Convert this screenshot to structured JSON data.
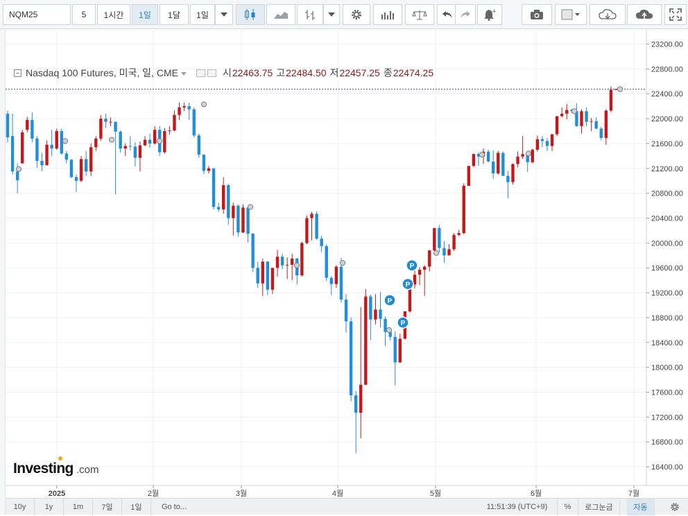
{
  "toolbar": {
    "symbol": "NQM25",
    "interval_value": "5",
    "buttons": [
      "1시간",
      "1일",
      "1달",
      "1일"
    ],
    "active_index": 1
  },
  "legend": {
    "title": "Nasdaq 100 Futures, 미국, 일, CME",
    "open_label": "시",
    "open": "22463.75",
    "high_label": "고",
    "high": "22484.50",
    "low_label": "저",
    "low": "22457.25",
    "close_label": "종",
    "close": "22474.25"
  },
  "colors": {
    "up": "#c8171b",
    "down": "#1e8fd8",
    "price_tag": "#1f8ad6",
    "grid": "#eef0f2"
  },
  "bottombar": {
    "ranges": [
      "10y",
      "1y",
      "1m",
      "7일",
      "1일"
    ],
    "goto": "Go to...",
    "clock": "11:51:39 (UTC+9)",
    "percent": "%",
    "log": "로그눈금",
    "auto": "자동"
  },
  "chart_data": {
    "type": "candlestick",
    "y_axis_ticks": [
      23200,
      22800,
      22400,
      22000,
      21600,
      21200,
      20800,
      20400,
      20000,
      19600,
      19200,
      18800,
      18400,
      18000,
      17600,
      17200,
      16800,
      16400
    ],
    "y_axis_tick_labels": [
      "23200.00",
      "22800.00",
      "22400.00",
      "22000.00",
      "21600.00",
      "21200.00",
      "20800.00",
      "20400.00",
      "20000.00",
      "19600.00",
      "19200.00",
      "18800.00",
      "18400.00",
      "18000.00",
      "17600.00",
      "17200.00",
      "16800.00",
      "16400.00"
    ],
    "ylim": [
      16100,
      23440
    ],
    "x_axis_labels": [
      "2025",
      "2월",
      "3월",
      "4월",
      "5월",
      "6월",
      "7월"
    ],
    "last_price": 22474.25,
    "last_price_label": "22474.25",
    "dividend_marker_label": "P",
    "candles": [
      [
        22080,
        22130,
        21620,
        21700
      ],
      [
        21720,
        22080,
        21100,
        21150
      ],
      [
        21150,
        21280,
        20800,
        21010
      ],
      [
        21280,
        21820,
        21280,
        21780
      ],
      [
        21820,
        22030,
        21780,
        21980
      ],
      [
        21980,
        22100,
        21620,
        21680
      ],
      [
        21680,
        21720,
        21210,
        21320
      ],
      [
        21320,
        21450,
        21150,
        21250
      ],
      [
        21250,
        21650,
        21250,
        21580
      ],
      [
        21580,
        21820,
        21400,
        21520
      ],
      [
        21520,
        21840,
        21500,
        21800
      ],
      [
        21800,
        21840,
        21420,
        21440
      ],
      [
        21440,
        21480,
        21280,
        21340
      ],
      [
        21340,
        21350,
        21040,
        21060
      ],
      [
        21060,
        21100,
        20820,
        21000
      ],
      [
        21000,
        21400,
        20980,
        21350
      ],
      [
        21350,
        21480,
        21080,
        21150
      ],
      [
        21150,
        21600,
        21080,
        21540
      ],
      [
        21540,
        21720,
        21480,
        21680
      ],
      [
        21680,
        22060,
        21640,
        22000
      ],
      [
        22000,
        22080,
        21850,
        21950
      ],
      [
        21950,
        22020,
        21880,
        21950
      ],
      [
        21950,
        21780,
        20780,
        21790
      ],
      [
        21790,
        21810,
        21450,
        21520
      ],
      [
        21520,
        21600,
        21400,
        21560
      ],
      [
        21560,
        21720,
        21490,
        21550
      ],
      [
        21550,
        21620,
        21230,
        21370
      ],
      [
        21370,
        21630,
        21150,
        21570
      ],
      [
        21570,
        21720,
        21560,
        21660
      ],
      [
        21660,
        21760,
        21530,
        21600
      ],
      [
        21600,
        21880,
        21580,
        21820
      ],
      [
        21820,
        21880,
        21400,
        21460
      ],
      [
        21460,
        21850,
        21440,
        21800
      ],
      [
        21800,
        21880,
        21740,
        21810
      ],
      [
        21810,
        22130,
        21800,
        22060
      ],
      [
        22060,
        22260,
        21980,
        22180
      ],
      [
        22180,
        22260,
        22120,
        22200
      ],
      [
        22200,
        22260,
        21980,
        22150
      ],
      [
        22150,
        22180,
        21700,
        21730
      ],
      [
        21730,
        21760,
        21370,
        21420
      ],
      [
        21420,
        21430,
        21110,
        21160
      ],
      [
        21160,
        21240,
        21120,
        21200
      ],
      [
        21200,
        21200,
        20540,
        20580
      ],
      [
        20580,
        20650,
        20500,
        20540
      ],
      [
        20540,
        21060,
        20470,
        20930
      ],
      [
        20930,
        20950,
        20290,
        20400
      ],
      [
        20400,
        20650,
        20120,
        20600
      ],
      [
        20600,
        20620,
        20100,
        20170
      ],
      [
        20170,
        20620,
        20160,
        20570
      ],
      [
        20570,
        20600,
        20010,
        20150
      ],
      [
        20150,
        20160,
        19530,
        19600
      ],
      [
        19600,
        19700,
        19280,
        19350
      ],
      [
        19350,
        19750,
        19150,
        19700
      ],
      [
        19700,
        19710,
        19160,
        19250
      ],
      [
        19250,
        19560,
        19180,
        19600
      ],
      [
        19600,
        19890,
        19460,
        19780
      ],
      [
        19780,
        19830,
        19580,
        19640
      ],
      [
        19640,
        19770,
        19420,
        19650
      ],
      [
        19650,
        19830,
        19400,
        19750
      ],
      [
        19750,
        19760,
        19330,
        19480
      ],
      [
        19480,
        20020,
        19460,
        20000
      ],
      [
        20000,
        20440,
        19980,
        20400
      ],
      [
        20400,
        20500,
        20040,
        20470
      ],
      [
        20470,
        20510,
        20050,
        20070
      ],
      [
        20070,
        20120,
        19850,
        19950
      ],
      [
        19950,
        19980,
        19390,
        19440
      ],
      [
        19440,
        19470,
        19160,
        19340
      ],
      [
        19340,
        19640,
        19280,
        19620
      ],
      [
        19620,
        19760,
        19040,
        19090
      ],
      [
        19090,
        19180,
        18560,
        18740
      ],
      [
        18740,
        18800,
        17450,
        17550
      ],
      [
        17550,
        17620,
        16620,
        17270
      ],
      [
        17270,
        18970,
        16860,
        17720
      ],
      [
        17720,
        19260,
        17720,
        19140
      ],
      [
        19140,
        19170,
        18440,
        18770
      ],
      [
        18770,
        19180,
        18690,
        18930
      ],
      [
        18930,
        19210,
        18640,
        18780
      ],
      [
        18780,
        18820,
        18340,
        18570
      ],
      [
        18570,
        18620,
        18430,
        18490
      ],
      [
        18490,
        18580,
        17710,
        18080
      ],
      [
        18080,
        18540,
        18070,
        18460
      ],
      [
        18460,
        18880,
        18450,
        18900
      ],
      [
        18900,
        19380,
        18880,
        19330
      ],
      [
        19330,
        19590,
        19270,
        19490
      ],
      [
        19490,
        19610,
        19320,
        19570
      ],
      [
        19570,
        19640,
        19150,
        19620
      ],
      [
        19620,
        19890,
        19540,
        19880
      ],
      [
        19880,
        20240,
        19810,
        20240
      ],
      [
        20240,
        20290,
        19850,
        19920
      ],
      [
        19920,
        20030,
        19680,
        19800
      ],
      [
        19800,
        19980,
        19820,
        19900
      ],
      [
        19900,
        20160,
        19870,
        20130
      ],
      [
        20130,
        20210,
        20110,
        20160
      ],
      [
        20160,
        20960,
        20140,
        20920
      ],
      [
        20920,
        21240,
        20980,
        21240
      ],
      [
        21240,
        21440,
        21220,
        21430
      ],
      [
        21430,
        21460,
        21240,
        21390
      ],
      [
        21390,
        21520,
        21270,
        21470
      ],
      [
        21470,
        21500,
        21300,
        21310
      ],
      [
        21310,
        21490,
        21030,
        21120
      ],
      [
        21120,
        21480,
        21100,
        21450
      ],
      [
        21450,
        21470,
        21080,
        21080
      ],
      [
        21080,
        21160,
        20720,
        20980
      ],
      [
        20980,
        21280,
        20940,
        21270
      ],
      [
        21270,
        21470,
        21220,
        21390
      ],
      [
        21390,
        21720,
        21350,
        21430
      ],
      [
        21430,
        21480,
        21140,
        21300
      ],
      [
        21300,
        21520,
        21280,
        21500
      ],
      [
        21500,
        21730,
        21470,
        21670
      ],
      [
        21670,
        21720,
        21540,
        21640
      ],
      [
        21640,
        21690,
        21480,
        21560
      ],
      [
        21560,
        21720,
        21480,
        21750
      ],
      [
        21750,
        22040,
        21720,
        22040
      ],
      [
        22040,
        22180,
        22020,
        22080
      ],
      [
        22080,
        22240,
        21990,
        22140
      ],
      [
        22140,
        22160,
        22090,
        22120
      ],
      [
        22120,
        22250,
        21870,
        21880
      ],
      [
        21880,
        22150,
        21760,
        22120
      ],
      [
        22120,
        22180,
        21880,
        21950
      ],
      [
        21950,
        22010,
        21800,
        21960
      ],
      [
        21960,
        22020,
        21830,
        21840
      ],
      [
        21840,
        21870,
        21650,
        21690
      ],
      [
        21690,
        22150,
        21580,
        22130
      ],
      [
        22130,
        22520,
        22100,
        22464
      ],
      [
        22464,
        22484,
        22457,
        22474
      ]
    ]
  }
}
